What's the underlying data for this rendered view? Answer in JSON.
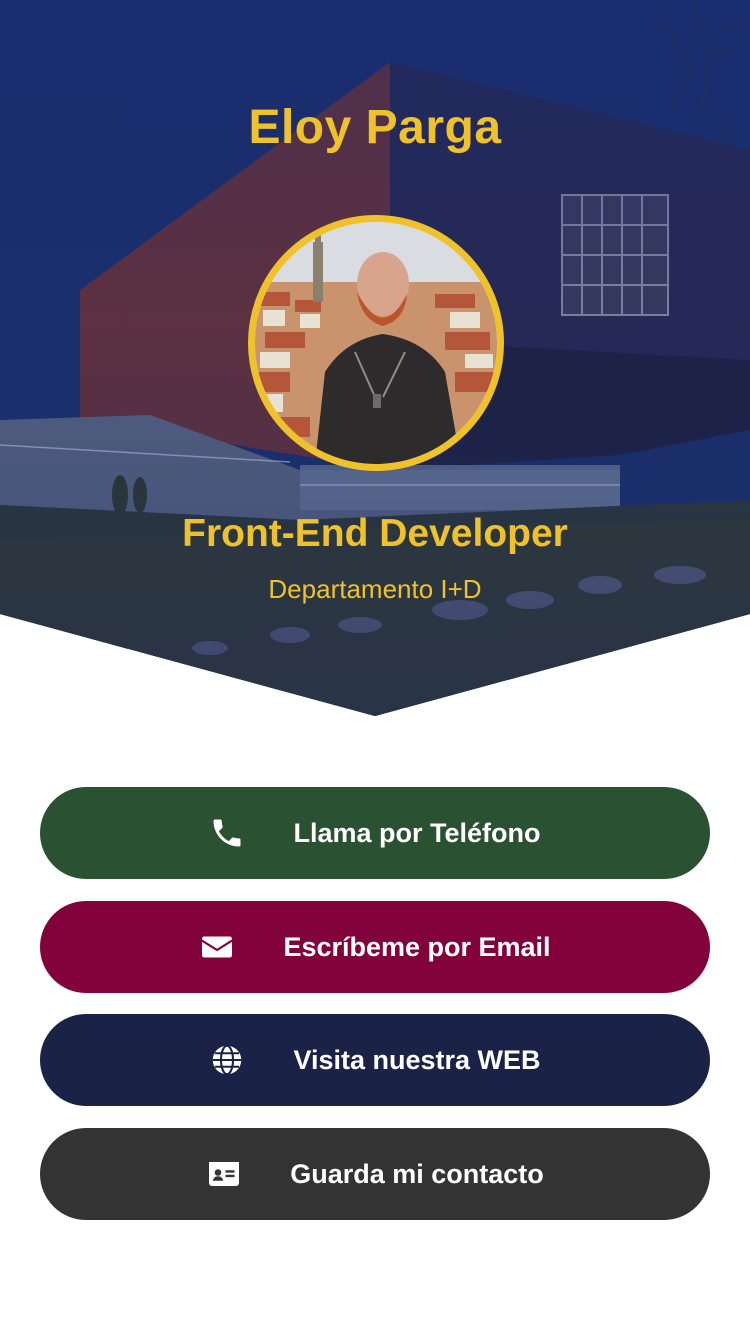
{
  "profile": {
    "name": "Eloy Parga",
    "role": "Front-End Developer",
    "department": "Departamento I+D"
  },
  "actions": [
    {
      "id": "phone",
      "label": "Llama por Teléfono",
      "icon": "phone-icon",
      "color": "#2a5232"
    },
    {
      "id": "email",
      "label": "Escríbeme por Email",
      "icon": "envelope-icon",
      "color": "#82033b"
    },
    {
      "id": "web",
      "label": "Visita nuestra WEB",
      "icon": "globe-icon",
      "color": "#1a2347"
    },
    {
      "id": "contact",
      "label": "Guarda mi contacto",
      "icon": "contact-card-icon",
      "color": "#333333"
    }
  ],
  "theme": {
    "accent": "#f0c22a",
    "hero_blue": "#1f2f66"
  }
}
